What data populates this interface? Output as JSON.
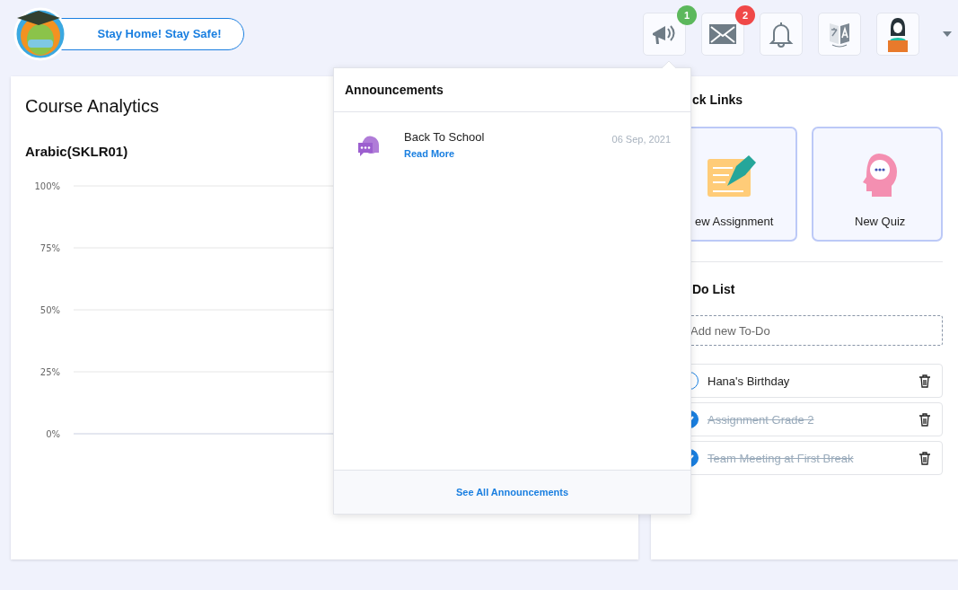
{
  "header": {
    "slogan": "Stay Home! Stay Safe!",
    "icons": [
      {
        "kind": "announcements",
        "badge": "1",
        "color": "#5cb85c"
      },
      {
        "kind": "messages",
        "badge": "2",
        "color": "#f04848"
      },
      {
        "kind": "notifications"
      },
      {
        "kind": "translate"
      },
      {
        "kind": "profile"
      }
    ]
  },
  "analytics": {
    "title": "Course Analytics",
    "course": "Arabic(SKLR01)",
    "chart_data": {
      "type": "bar",
      "categories": [
        null
      ],
      "values": [
        null
      ],
      "grid": true,
      "ylim": [
        0,
        100
      ],
      "yticks": [
        {
          "value": 100,
          "label": "100%"
        },
        {
          "value": 75,
          "label": "75%"
        },
        {
          "value": 50,
          "label": "50%"
        },
        {
          "value": 25,
          "label": "25%"
        },
        {
          "value": 0,
          "label": "0%"
        }
      ]
    }
  },
  "announcements": {
    "title": "Announcements",
    "items": [
      {
        "title": "Back To School",
        "link": "Read More",
        "date": "06 Sep, 2021"
      }
    ],
    "footer": "See All Announcements"
  },
  "quick_links": {
    "title": "ck Links",
    "items": [
      {
        "kind": "assignment",
        "label": "ew Assignment"
      },
      {
        "kind": "quiz",
        "label": "New Quiz"
      }
    ]
  },
  "todo": {
    "title": "Do List",
    "placeholder": "Add new To-Do",
    "items": [
      {
        "text": "Hana's Birthday",
        "checked": false
      },
      {
        "text": "Assignment Grade 2",
        "checked": true
      },
      {
        "text": "Team Meeting at First Break",
        "checked": true
      }
    ]
  }
}
